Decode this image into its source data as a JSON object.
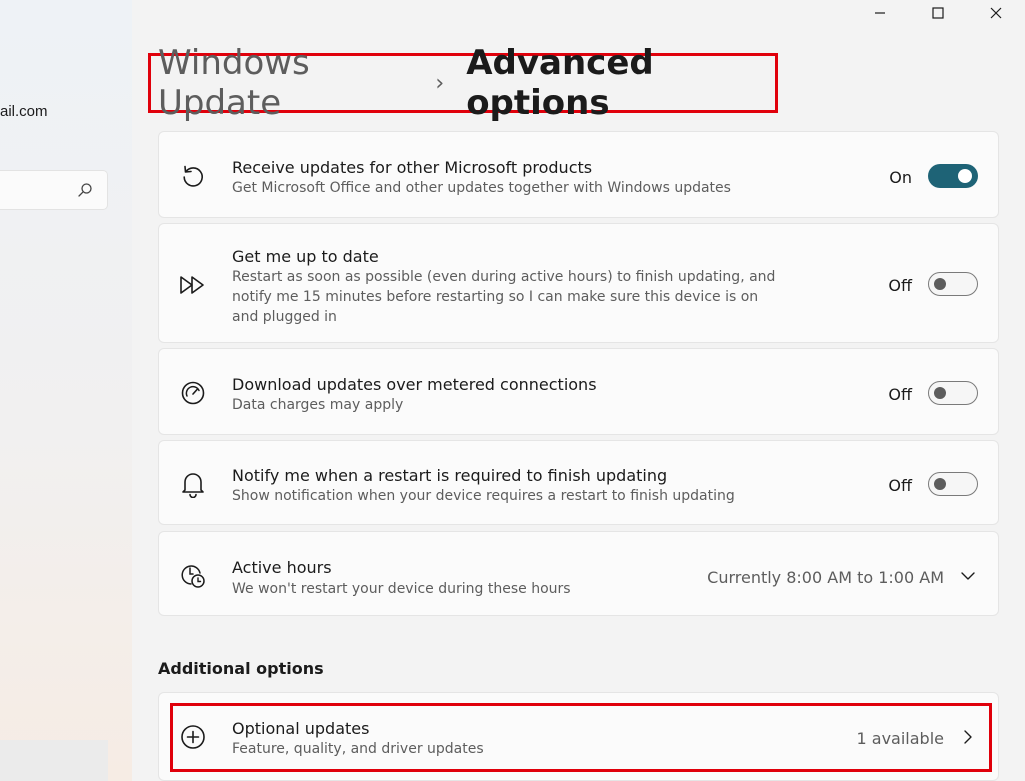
{
  "window": {
    "controls": {
      "minimize": "—",
      "maximize": "☐",
      "close": "✕"
    }
  },
  "sidebar": {
    "account_email": "ail.com",
    "search_icon": "search-icon"
  },
  "breadcrumb": {
    "parent": "Windows Update",
    "separator": "›",
    "current": "Advanced options"
  },
  "settings": {
    "receive_updates": {
      "title": "Receive updates for other Microsoft products",
      "description": "Get Microsoft Office and other updates together with Windows updates",
      "state": "On",
      "icon": "refresh-icon"
    },
    "get_up_to_date": {
      "title": "Get me up to date",
      "description_line1": "Restart as soon as possible (even during active hours) to finish updating, and",
      "description_line2": "notify me 15 minutes before restarting so I can make sure this device is on",
      "description_line3": "and plugged in",
      "state": "Off",
      "icon": "fast-forward-icon"
    },
    "metered": {
      "title": "Download updates over metered connections",
      "description": "Data charges may apply",
      "state": "Off",
      "icon": "gauge-icon"
    },
    "notify_restart": {
      "title": "Notify me when a restart is required to finish updating",
      "description": "Show notification when your device requires a restart to finish updating",
      "state": "Off",
      "icon": "bell-icon"
    },
    "active_hours": {
      "title": "Active hours",
      "description": "We won't restart your device during these hours",
      "value": "Currently 8:00 AM to 1:00 AM",
      "icon": "clock-icon"
    }
  },
  "additional": {
    "heading": "Additional options",
    "optional_updates": {
      "title": "Optional updates",
      "description": "Feature, quality, and driver updates",
      "status": "1 available",
      "icon": "plus-circle-icon"
    }
  },
  "colors": {
    "accent": "#1e6376",
    "highlight_border": "#e0000b"
  }
}
